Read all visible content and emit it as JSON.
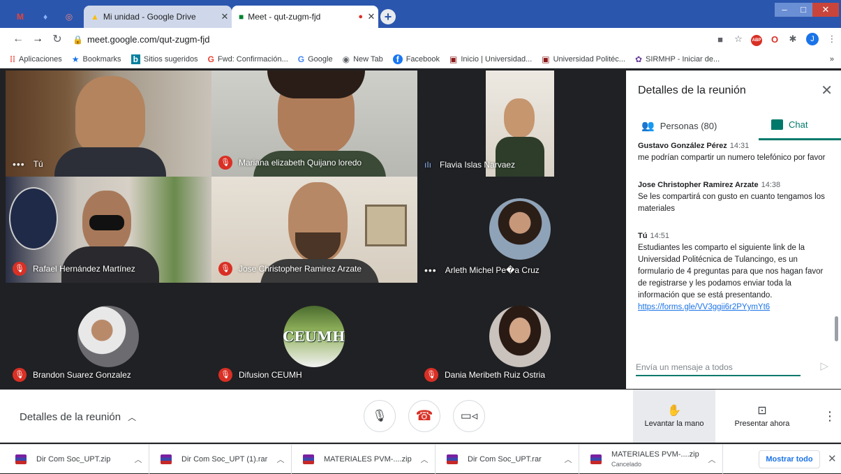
{
  "tabs": [
    {
      "label": "Mi unidad - Google Drive",
      "icon": "google-drive-icon"
    },
    {
      "label": "Meet - qut-zugm-fjd",
      "icon": "google-meet-icon",
      "active": true
    }
  ],
  "address": {
    "url": "meet.google.com/qut-zugm-fjd"
  },
  "bookmarks": [
    {
      "label": "Aplicaciones",
      "icon": "apps-grid-icon"
    },
    {
      "label": "Bookmarks",
      "icon": "star-icon"
    },
    {
      "label": "Sitios sugeridos",
      "icon": "bing-icon"
    },
    {
      "label": "Fwd: Confirmación...",
      "icon": "google-g-icon"
    },
    {
      "label": "Google",
      "icon": "google-g-icon"
    },
    {
      "label": "New Tab",
      "icon": "globe-icon"
    },
    {
      "label": "Facebook",
      "icon": "facebook-icon"
    },
    {
      "label": "Inicio | Universidad...",
      "icon": "university-icon"
    },
    {
      "label": "Universidad Politéc...",
      "icon": "university-icon"
    },
    {
      "label": "SIRMHP - Iniciar de...",
      "icon": "sirmhp-icon"
    }
  ],
  "participants": [
    {
      "name": "Tú",
      "status": "dots"
    },
    {
      "name": "Mariana elizabeth Quijano loredo",
      "status": "muted"
    },
    {
      "name": "Flavia Islas Narvaez",
      "status": "speaking"
    },
    {
      "name": "Rafael Hernández Martínez",
      "status": "muted"
    },
    {
      "name": "Jose Christopher Ramirez Arzate",
      "status": "muted"
    },
    {
      "name": "Arleth Michel Pe�a Cruz",
      "status": "dots"
    },
    {
      "name": "Brandon Suarez Gonzalez",
      "status": "muted"
    },
    {
      "name": "Difusion CEUMH",
      "status": "muted"
    },
    {
      "name": "Dania Meribeth Ruiz Ostria",
      "status": "muted"
    }
  ],
  "ceumh_logo_text": "CEUMH",
  "panel": {
    "title": "Detalles de la reunión",
    "people_tab": "Personas (80)",
    "chat_tab": "Chat",
    "messages": [
      {
        "author": "Gustavo González Pérez",
        "time": "14:31",
        "text": "me podrían compartir  un numero telefónico por favor",
        "link": ""
      },
      {
        "author": "Jose Christopher Ramirez Arzate",
        "time": "14:38",
        "text": "Se les compartirá con gusto en cuanto tengamos los materiales",
        "link": ""
      },
      {
        "author": "Tú",
        "time": "14:51",
        "text": "Estudiantes les comparto el siguiente link de la Universidad Politécnica de Tulancingo, es un formulario de 4 preguntas para que nos hagan favor de registrarse y les podamos enviar toda la información que se está presentando.",
        "link": "https://forms.gle/VV3ggii6r2PYymYt6"
      }
    ],
    "input_placeholder": "Envía un mensaje a todos"
  },
  "bottom": {
    "meeting_details": "Detalles de la reunión",
    "raise_hand": "Levantar la mano",
    "present_now": "Presentar ahora"
  },
  "downloads": {
    "items": [
      {
        "name": "Dir Com Soc_UPT.zip",
        "sub": ""
      },
      {
        "name": "Dir Com Soc_UPT (1).rar",
        "sub": ""
      },
      {
        "name": "MATERIALES PVM-....zip",
        "sub": ""
      },
      {
        "name": "Dir Com Soc_UPT.rar",
        "sub": ""
      },
      {
        "name": "MATERIALES PVM-....zip",
        "sub": "Cancelado"
      }
    ],
    "show_all": "Mostrar todo"
  },
  "colors": {
    "accent": "#00796b",
    "mute": "#d93025",
    "tabbar": "#2b56ae",
    "hangup": "#d93025"
  }
}
